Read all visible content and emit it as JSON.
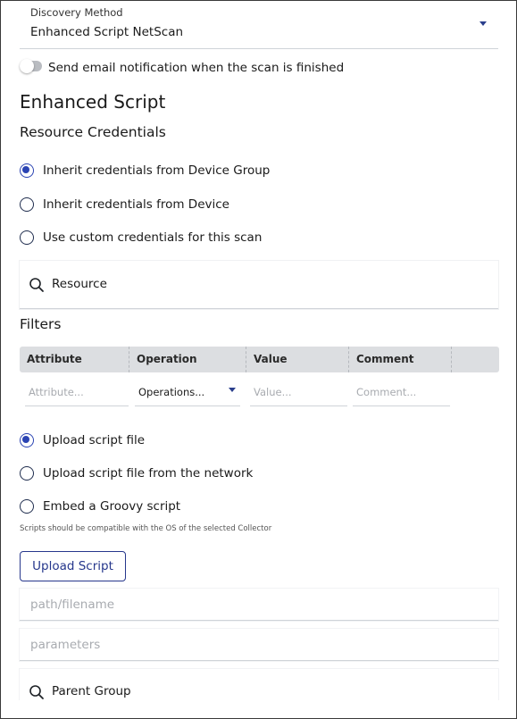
{
  "discovery_method": {
    "label": "Discovery Method",
    "value": "Enhanced Script NetScan"
  },
  "email_toggle": {
    "label": "Send email notification when the scan is finished",
    "checked": false
  },
  "section_title": "Enhanced Script",
  "credentials": {
    "title": "Resource Credentials",
    "options": [
      {
        "label": "Inherit credentials from Device Group",
        "checked": true
      },
      {
        "label": "Inherit credentials from Device",
        "checked": false
      },
      {
        "label": "Use custom credentials for this scan",
        "checked": false
      }
    ]
  },
  "resource_search": {
    "text": "Resource"
  },
  "filters": {
    "title": "Filters",
    "columns": [
      "Attribute",
      "Operation",
      "Value",
      "Comment"
    ],
    "placeholders": {
      "attribute": "Attribute...",
      "operation": "Operations...",
      "value": "Value...",
      "comment": "Comment..."
    }
  },
  "script_source": {
    "options": [
      {
        "label": "Upload script file",
        "checked": true
      },
      {
        "label": "Upload script file from the network",
        "checked": false
      },
      {
        "label": "Embed a Groovy script",
        "checked": false
      }
    ],
    "hint": "Scripts should be compatible with the OS of the selected Collector"
  },
  "upload_button": "Upload Script",
  "path_field": {
    "placeholder": "path/filename"
  },
  "parameters_field": {
    "placeholder": "parameters"
  },
  "parent_group_search": {
    "text": "Parent Group"
  },
  "colors": {
    "accent": "#2b44b3",
    "button_border": "#26378c",
    "table_header": "#dcdee1"
  }
}
